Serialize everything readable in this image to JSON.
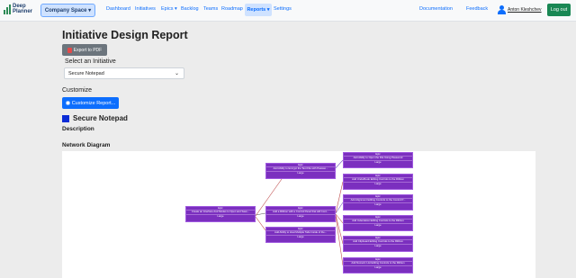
{
  "navbar": {
    "logo_line1": "Deep",
    "logo_line2": "Planner",
    "space_button": "Company Space ▾",
    "links": {
      "dashboard": "Dashboard",
      "initiatives": "Initiatives",
      "epics": "Epics ▾",
      "backlog": "Backlog",
      "teams": "Teams",
      "roadmap": "Roadmap",
      "reports": "Reports ▾",
      "settings": "Settings"
    },
    "documentation": "Documentation",
    "feedback": "Feedback",
    "user_name": "Anton Kleshchev",
    "logout": "Log out"
  },
  "page": {
    "title": "Initiative Design Report",
    "export_button": "Export to PDF",
    "select_label": "Select an Initiative",
    "select_value": "Secure Notepad",
    "customize_label": "Customize",
    "customize_button": "Customize Report...",
    "initiative_name": "Secure Notepad",
    "initiative_color": "#0b2cd6",
    "description_label": "Description",
    "network_label": "Network Diagram"
  },
  "diagram": {
    "nodes": [
      {
        "type": "Epic",
        "title": "Create an Interface And Modes to Open and Save...",
        "size": "Large"
      },
      {
        "type": "Epic",
        "title": "Add Ability to Encrypt the Text File with Passwo...",
        "size": "Large"
      },
      {
        "type": "Epic",
        "title": "Add a Ribbon with a Control Panel that will Cont...",
        "size": "Large"
      },
      {
        "type": "Epic",
        "title": "Add Ability to Host Multiple Tabs Inside of the...",
        "size": "Large"
      },
      {
        "type": "Epic",
        "title": "Add Ability to Open the File Using Password",
        "size": "Large"
      },
      {
        "type": "Epic",
        "title": "Add Undo/Redo Editing Controls to the Ribbon",
        "size": "Large"
      },
      {
        "type": "Epic",
        "title": "Add Alignment Editing Controls to the Control P...",
        "size": "Large"
      },
      {
        "type": "Epic",
        "title": "Add Indentation Editing Controls to the Ribbon",
        "size": "Large"
      },
      {
        "type": "Epic",
        "title": "Add Clipboard Editing Controls to the Ribbon",
        "size": "Large"
      },
      {
        "type": "Epic",
        "title": "Add Numeric List Editing Controls to the Ribbon",
        "size": "Large"
      }
    ]
  }
}
